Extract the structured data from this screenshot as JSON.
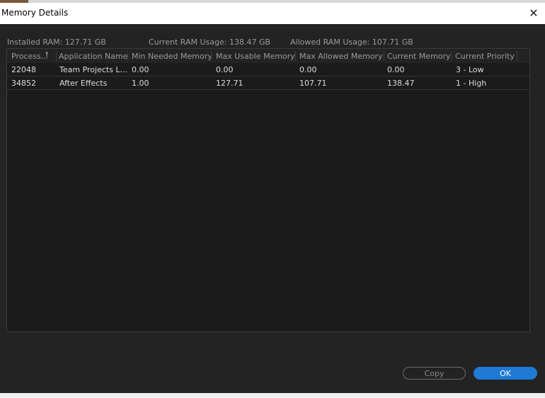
{
  "window": {
    "title": "Memory Details"
  },
  "stats": {
    "installed": "Installed RAM: 127.71 GB",
    "current": "Current RAM Usage: 138.47 GB",
    "allowed": "Allowed RAM Usage: 107.71 GB"
  },
  "table": {
    "columns": [
      "Process...",
      "Application Name",
      "Min Needed Memory",
      "Max Usable Memory",
      "Max Allowed Memory",
      "Current Memory",
      "Current Priority"
    ],
    "sort_icon": "arrow-up-icon",
    "rows": [
      [
        "22048",
        "Team Projects L...",
        "0.00",
        "0.00",
        "0.00",
        "0.00",
        "3 - Low"
      ],
      [
        "34852",
        "After Effects",
        "1.00",
        "127.71",
        "107.71",
        "138.47",
        "1 - High"
      ]
    ]
  },
  "buttons": {
    "copy": "Copy",
    "ok": "OK"
  },
  "colors": {
    "accent": "#1f7ad6",
    "panel": "#232323"
  }
}
